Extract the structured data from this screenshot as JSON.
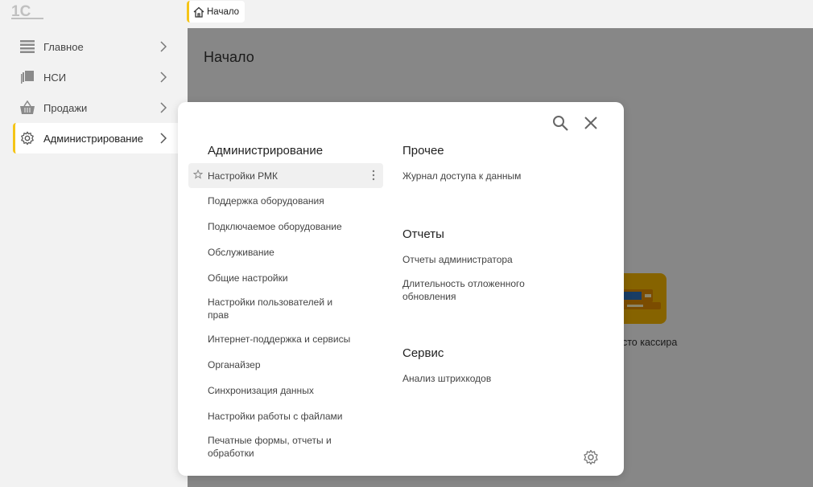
{
  "app": {
    "logo_text": "1С"
  },
  "tabs": [
    {
      "label": "Начало"
    }
  ],
  "sidebar": {
    "items": [
      {
        "label": "Главное",
        "icon": "menu-lines-icon"
      },
      {
        "label": "НСИ",
        "icon": "documents-icon"
      },
      {
        "label": "Продажи",
        "icon": "basket-icon"
      },
      {
        "label": "Администрирование",
        "icon": "gear-icon",
        "active": true
      }
    ]
  },
  "main": {
    "title": "Начало",
    "tile_label": "е место кассира"
  },
  "panel": {
    "left": {
      "title": "Администрирование",
      "items": [
        "Настройки РМК",
        "Поддержка оборудования",
        "Подключаемое оборудование",
        "Обслуживание",
        "Общие настройки",
        "Настройки пользователей и прав",
        "Интернет-поддержка и сервисы",
        "Органайзер",
        "Синхронизация данных",
        "Настройки работы с файлами",
        "Печатные формы, отчеты и обработки"
      ]
    },
    "right": [
      {
        "title": "Прочее",
        "items": [
          "Журнал доступа к данным"
        ]
      },
      {
        "title": "Отчеты",
        "items": [
          "Отчеты администратора",
          "Длительность отложенного обновления"
        ]
      },
      {
        "title": "Сервис",
        "items": [
          "Анализ штрихкодов"
        ]
      }
    ]
  },
  "colors": {
    "accent": "#f5c518",
    "tile": "#f4b400"
  }
}
